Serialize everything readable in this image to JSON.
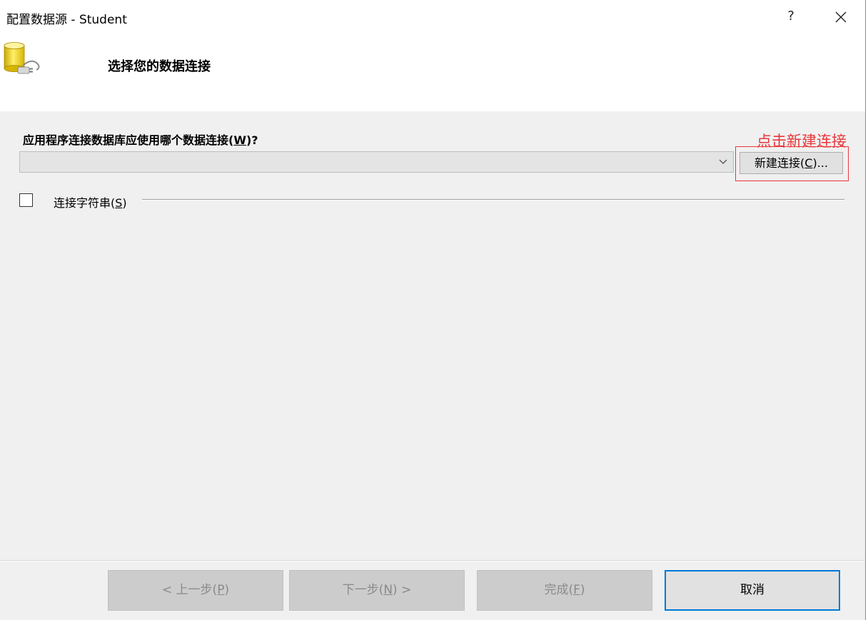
{
  "window": {
    "title": "配置数据源 - Student",
    "help_label": "?"
  },
  "header": {
    "icon": "database-connection-icon",
    "heading": "选择您的数据连接"
  },
  "main": {
    "question": "应用程序连接数据库应使用哪个数据连接(W)?",
    "question_pre": "应用程序连接数据库应使用哪个数据连接(",
    "question_key": "W",
    "question_post": ")?",
    "connection_select_value": "",
    "new_connection_button": {
      "pre": "新建连接(",
      "key": "C",
      "post": ")..."
    },
    "connection_string_checkbox": {
      "checked": false,
      "pre": "连接字符串(",
      "key": "S",
      "post": ")"
    }
  },
  "annotation": {
    "text": "点击新建连接",
    "color": "#e8383d"
  },
  "footer": {
    "back": {
      "pre": "< 上一步(",
      "key": "P",
      "post": ")",
      "enabled": false
    },
    "next": {
      "pre": "下一步(",
      "key": "N",
      "post": ") >",
      "enabled": false
    },
    "finish": {
      "pre": "完成(",
      "key": "F",
      "post": ")",
      "enabled": false
    },
    "cancel": {
      "label": "取消",
      "enabled": true
    }
  },
  "colors": {
    "accent": "#0078d7",
    "annotation": "#e8383d",
    "dialog_bg": "#f0f0f0"
  }
}
